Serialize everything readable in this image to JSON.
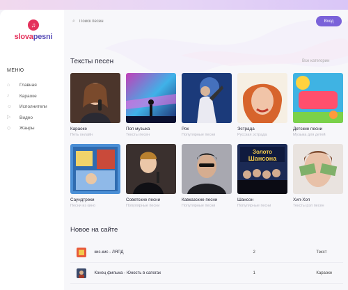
{
  "logo": {
    "part1": "slova",
    "part2": "pesni"
  },
  "sidebar": {
    "menu_title": "МЕНЮ",
    "items": [
      {
        "label": "Главная",
        "icon": "home-icon"
      },
      {
        "label": "Караоке",
        "icon": "microphone-icon"
      },
      {
        "label": "Исполнители",
        "icon": "user-icon"
      },
      {
        "label": "Видео",
        "icon": "video-icon"
      },
      {
        "label": "Жанры",
        "icon": "genre-icon"
      }
    ]
  },
  "header": {
    "search_placeholder": "Поиск песен",
    "login_label": "Вход"
  },
  "songs_section": {
    "title": "Тексты песен",
    "view_all": "Все категории",
    "categories": [
      {
        "name": "Караоке",
        "sub": "Петь онлайн"
      },
      {
        "name": "Поп музыка",
        "sub": "Тексты песен"
      },
      {
        "name": "Рок",
        "sub": "Популярные песни"
      },
      {
        "name": "Эстрада",
        "sub": "Русская эстрада"
      },
      {
        "name": "Детские песни",
        "sub": "Музыка для детей"
      },
      {
        "name": "Саундтреки",
        "sub": "Песни из кино"
      },
      {
        "name": "Советские песни",
        "sub": "Популярные песни"
      },
      {
        "name": "Кавказские песни",
        "sub": "Популярные песни"
      },
      {
        "name": "Шансон",
        "sub": "Популярные песни"
      },
      {
        "name": "Хип-Хоп",
        "sub": "Тексты рэп песен"
      }
    ]
  },
  "new_section": {
    "title": "Новое на сайте",
    "rows": [
      {
        "title": "кис-кис - ЛЯПД",
        "count": "2",
        "type": "Текст"
      },
      {
        "title": "Конец фильма - Юность в сапогах",
        "count": "1",
        "type": "Караоке"
      }
    ]
  },
  "colors": {
    "accent": "#7a62d9",
    "logo_red": "#e4315b",
    "logo_purple": "#5a4fb8"
  }
}
